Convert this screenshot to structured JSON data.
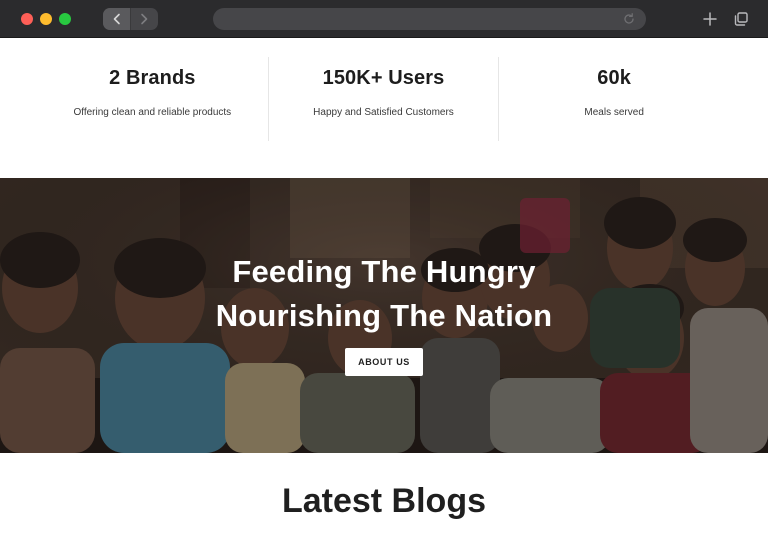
{
  "browser": {
    "icons": {
      "back": "chevron-left-icon",
      "forward": "chevron-right-icon",
      "reload": "reload-icon",
      "new_tab": "plus-icon",
      "tabs": "tabs-overview-icon"
    },
    "colors": {
      "close": "#fe5f57",
      "minimize": "#febc2e",
      "zoom": "#28c840"
    }
  },
  "stats": [
    {
      "value": "2 Brands",
      "caption": "Offering clean and reliable products"
    },
    {
      "value": "150K+ Users",
      "caption": "Happy and Satisfied Customers"
    },
    {
      "value": "60k",
      "caption": "Meals served"
    }
  ],
  "hero": {
    "title_line1": "Feeding The Hungry",
    "title_line2": "Nourishing The Nation",
    "button_label": "ABOUT US"
  },
  "blogs": {
    "heading": "Latest Blogs"
  }
}
